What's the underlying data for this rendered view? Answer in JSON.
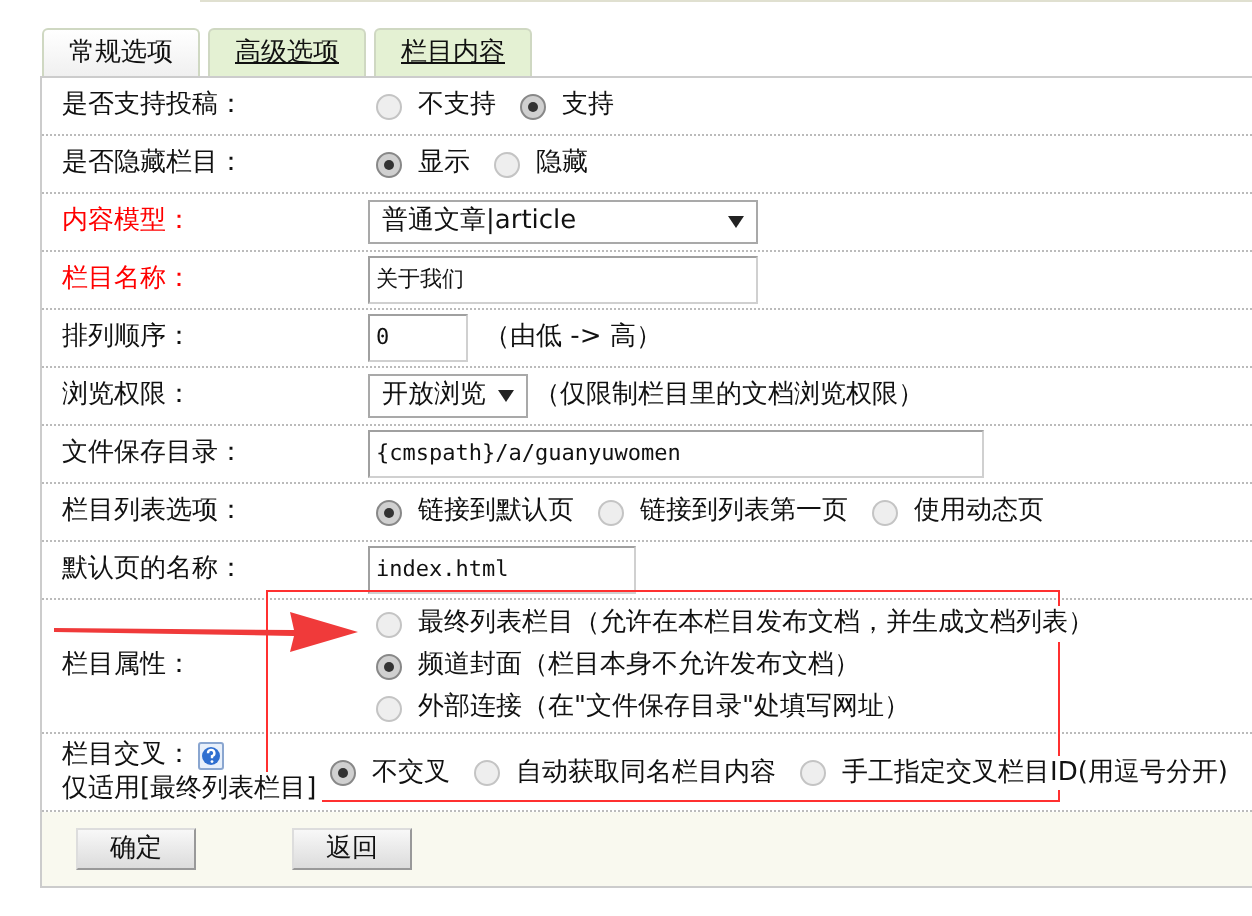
{
  "tabs": [
    {
      "label": "常规选项",
      "selected": true
    },
    {
      "label": "高级选项",
      "selected": false
    },
    {
      "label": "栏目内容",
      "selected": false
    }
  ],
  "rows": [
    {
      "kind": "radio",
      "label": "是否支持投稿：",
      "required": false,
      "options": [
        {
          "label": "不支持",
          "selected": false
        },
        {
          "label": "支持",
          "selected": true
        }
      ]
    },
    {
      "kind": "radio",
      "label": "是否隐藏栏目：",
      "required": false,
      "options": [
        {
          "label": "显示",
          "selected": true
        },
        {
          "label": "隐藏",
          "selected": false
        }
      ]
    },
    {
      "kind": "select",
      "label": "内容模型：",
      "required": true,
      "value": "普通文章|article"
    },
    {
      "kind": "text",
      "label": "栏目名称：",
      "required": true,
      "value": "关于我们"
    },
    {
      "kind": "text",
      "label": "排列顺序：",
      "required": false,
      "value": "0",
      "note": "（由低 -> 高）"
    },
    {
      "kind": "select",
      "label": "浏览权限：",
      "required": false,
      "value": "开放浏览",
      "note": "（仅限制栏目里的文档浏览权限）"
    },
    {
      "kind": "text",
      "label": "文件保存目录：",
      "required": false,
      "value": "{cmspath}/a/guanyuwomen"
    },
    {
      "kind": "radio",
      "label": "栏目列表选项：",
      "required": false,
      "options": [
        {
          "label": "链接到默认页",
          "selected": true
        },
        {
          "label": "链接到列表第一页",
          "selected": false
        },
        {
          "label": "使用动态页",
          "selected": false
        }
      ]
    },
    {
      "kind": "text",
      "label": "默认页的名称：",
      "required": false,
      "value": "index.html"
    },
    {
      "kind": "stack",
      "label": "栏目属性：",
      "required": false,
      "options": [
        {
          "label": "最终列表栏目（允许在本栏目发布文档，并生成文档列表）",
          "selected": false
        },
        {
          "label": "频道封面（栏目本身不允许发布文档）",
          "selected": true
        },
        {
          "label": "外部连接（在\"文件保存目录\"处填写网址）",
          "selected": false
        }
      ]
    },
    {
      "kind": "radio",
      "label": "栏目交叉：",
      "sublabel": "仅适用[最终列表栏目]",
      "help": true,
      "required": false,
      "options": [
        {
          "label": "不交叉",
          "selected": true
        },
        {
          "label": "自动获取同名栏目内容",
          "selected": false
        },
        {
          "label": "手工指定交叉栏目ID(用逗号分开)",
          "selected": false
        }
      ]
    }
  ],
  "buttons": [
    "确定",
    "返回"
  ]
}
